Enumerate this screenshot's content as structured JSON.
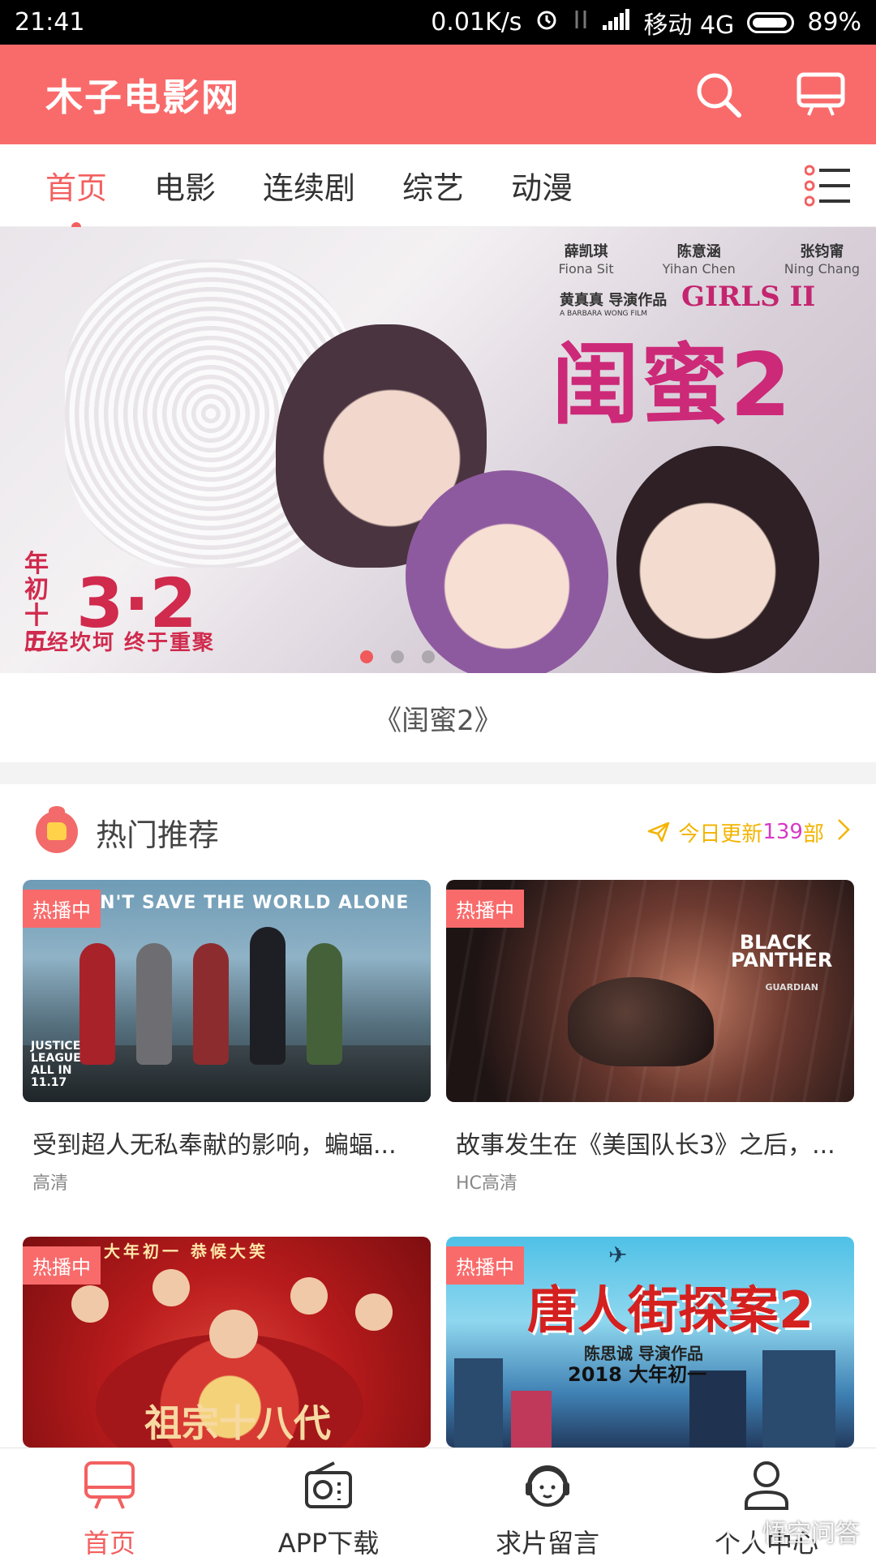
{
  "status_bar": {
    "time": "21:41",
    "speed": "0.01K/s",
    "carrier": "移动 4G",
    "battery": "89%",
    "icons": [
      "alarm-icon",
      "data-off-icon",
      "signal-icon",
      "battery-icon"
    ]
  },
  "header": {
    "title": "木子电影网",
    "icons": [
      "search-icon",
      "tv-icon"
    ],
    "accent_color": "#f96b6b"
  },
  "tabs": {
    "items": [
      "首页",
      "电影",
      "连续剧",
      "综艺",
      "动漫"
    ],
    "active_index": 0,
    "menu_icon": "list-menu-icon"
  },
  "banner": {
    "credits": [
      {
        "cn": "薛凯琪",
        "en": "Fiona Sit"
      },
      {
        "cn": "陈意涵",
        "en": "Yihan Chen"
      },
      {
        "cn": "张钧甯",
        "en": "Ning Chang"
      }
    ],
    "director": "黄真真 导演作品",
    "director_en": "A BARBARA WONG FILM",
    "girls_logo": "GIRLS II",
    "title": "闺蜜2",
    "date_prefix": "年初 十五",
    "date": "3·2",
    "tagline": "历经坎坷 终于重聚",
    "slides": 3,
    "active_slide": 0,
    "caption": "《闺蜜2》"
  },
  "section": {
    "icon": "thumbs-up-icon",
    "title": "热门推荐",
    "update_prefix": "今日更新",
    "update_count": "139",
    "update_suffix": "部",
    "send_icon": "send-icon",
    "arrow_icon": "chevron-right-icon"
  },
  "cards": [
    {
      "badge": "热播中",
      "title": "受到超人无私奉献的影响，蝙蝠...",
      "quality": "高清",
      "poster_text": "CAN'T SAVE THE WORLD ALONE",
      "poster_logo": "JUSTICE LEAGUE ALL IN 11.17"
    },
    {
      "badge": "热播中",
      "title": "故事发生在《美国队长3》之后，...",
      "quality": "HC高清",
      "poster_text": "BLACK PANTHER",
      "poster_sub": "GUARDIAN"
    },
    {
      "badge": "热播中",
      "title": "",
      "quality": "",
      "poster_text": "大年初一 恭候大笑",
      "poster_logo": "祖宗十八代"
    },
    {
      "badge": "热播中",
      "title": "",
      "quality": "",
      "poster_text": "唐人街探案2",
      "poster_sub": "陈思诚 导演作品",
      "poster_sub2": "2018 大年初一"
    }
  ],
  "bottom_nav": {
    "items": [
      {
        "label": "首页",
        "icon": "tv-home-icon"
      },
      {
        "label": "APP下载",
        "icon": "radio-icon"
      },
      {
        "label": "求片留言",
        "icon": "headset-icon"
      },
      {
        "label": "个人中心",
        "icon": "user-icon"
      }
    ],
    "active_index": 0
  },
  "watermark": "悟空问答"
}
